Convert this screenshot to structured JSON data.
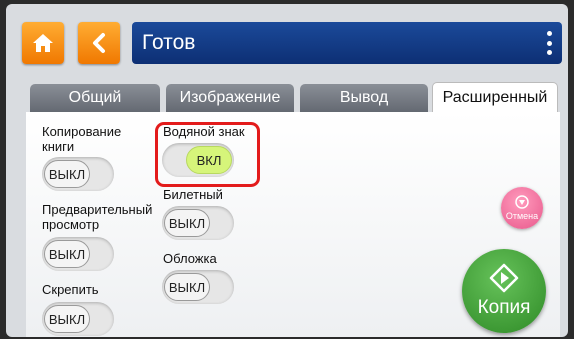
{
  "header": {
    "title": "Готов",
    "home_icon": "home-icon",
    "back_icon": "chevron-left-icon",
    "menu_icon": "kebab-menu-icon"
  },
  "tabs": [
    {
      "label": "Общий",
      "active": false
    },
    {
      "label": "Изображение",
      "active": false
    },
    {
      "label": "Вывод",
      "active": false
    },
    {
      "label": "Расширенный",
      "active": true
    }
  ],
  "settings": {
    "book_copy": {
      "label": "Копирование книги",
      "value": "ВЫКЛ",
      "on": false
    },
    "preview": {
      "label": "Предварительный просмотр",
      "value": "ВЫКЛ",
      "on": false
    },
    "staple": {
      "label": "Скрепить",
      "value": "ВЫКЛ",
      "on": false
    },
    "watermark": {
      "label": "Водяной знак",
      "value": "ВКЛ",
      "on": true
    },
    "ticket": {
      "label": "Билетный",
      "value": "ВЫКЛ",
      "on": false
    },
    "cover": {
      "label": "Обложка",
      "value": "ВЫКЛ",
      "on": false
    }
  },
  "actions": {
    "cancel": {
      "label": "Отмена",
      "color": "#e8588b",
      "icon": "stop-icon"
    },
    "copy": {
      "label": "Копия",
      "color": "#2e8a26",
      "icon": "start-icon"
    }
  },
  "colors": {
    "accent_orange": "#f07800",
    "title_bar": "#0d2f74",
    "toggle_on": "#d6f57a",
    "highlight": "#e31b1b"
  }
}
